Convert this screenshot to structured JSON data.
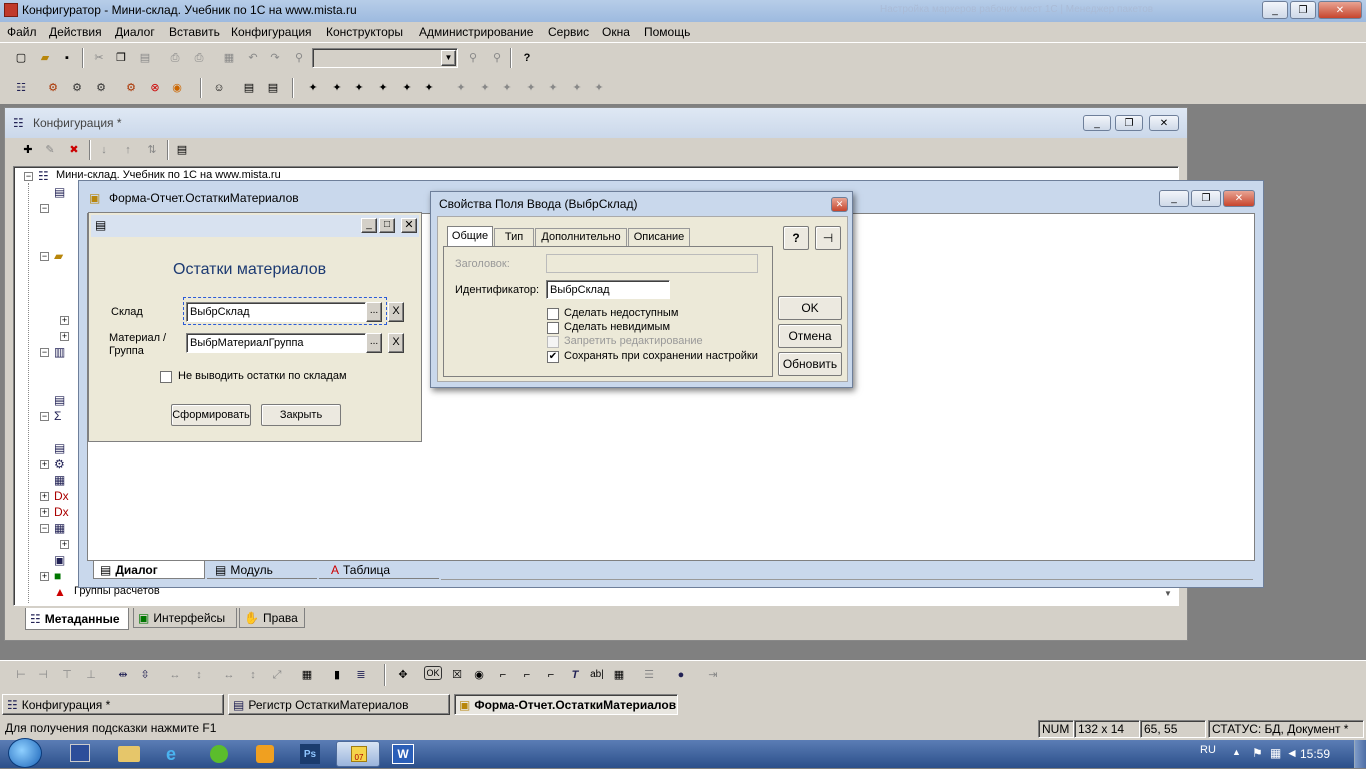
{
  "app": {
    "title": "Конфигуратор - Мини-склад. Учебник по 1С на www.mista.ru",
    "faded_title": "Настройка маркеров рабочих мест 1С | Менеджер пакетов",
    "min_label": "_",
    "restore_label": "❐",
    "close_label": "✕"
  },
  "menu": [
    "Файл",
    "Действия",
    "Диалог",
    "Вставить",
    "Конфигурация",
    "Конструкторы",
    "Администрирование",
    "Сервис",
    "Окна",
    "Помощь"
  ],
  "config_window": {
    "title": "Конфигурация *",
    "tree_root": "Мини-склад. Учебник по 1С на www.mista.ru",
    "tree_last": "Группы расчетов",
    "tabs": [
      "Метаданные",
      "Интерфейсы",
      "Права"
    ]
  },
  "form_window": {
    "title": "Форма-Отчет.ОстаткиМатериалов",
    "tabs": [
      "Диалог",
      "Модуль",
      "Таблица"
    ]
  },
  "dialog_form": {
    "heading": "Остатки материалов",
    "sklad_label": "Склад",
    "sklad_value": "ВыбрСклад",
    "material_label_1": "Материал /",
    "material_label_2": "Группа",
    "material_value": "ВыбрМатериалГруппа",
    "ellipsis": "...",
    "clear": "X",
    "checkbox_label": "Не выводить остатки по складам",
    "btn_generate": "Сформировать",
    "btn_close": "Закрыть"
  },
  "properties": {
    "title": "Свойства  Поля Ввода (ВыбрСклад)",
    "tabs": [
      "Общие",
      "Тип",
      "Дополнительно",
      "Описание"
    ],
    "caption_label": "Заголовок:",
    "caption_value": "",
    "id_label": "Идентификатор:",
    "id_value": "ВыбрСклад",
    "options": [
      {
        "label": "Сделать недоступным",
        "checked": false,
        "disabled": false
      },
      {
        "label": "Сделать невидимым",
        "checked": false,
        "disabled": false
      },
      {
        "label": "Запретить редактирование",
        "checked": false,
        "disabled": true
      },
      {
        "label": "Сохранять при сохранении настройки",
        "checked": true,
        "disabled": false
      }
    ],
    "help_label": "?",
    "pin_label": "⊣",
    "ok": "OK",
    "cancel": "Отмена",
    "refresh": "Обновить"
  },
  "mdi_tasks": [
    "Конфигурация *",
    "Регистр ОстаткиМатериалов",
    "Форма-Отчет.ОстаткиМатериалов"
  ],
  "status": {
    "hint": "Для получения подсказки нажмите F1",
    "num": "NUM",
    "size": "132 x 14",
    "pos": "65, 55",
    "state": "СТАТУС: БД, Документ *"
  },
  "taskbar": {
    "lang": "RU",
    "time": "15:59",
    "app_w": "W",
    "app_ps": "Ps",
    "badge_07": "07"
  }
}
